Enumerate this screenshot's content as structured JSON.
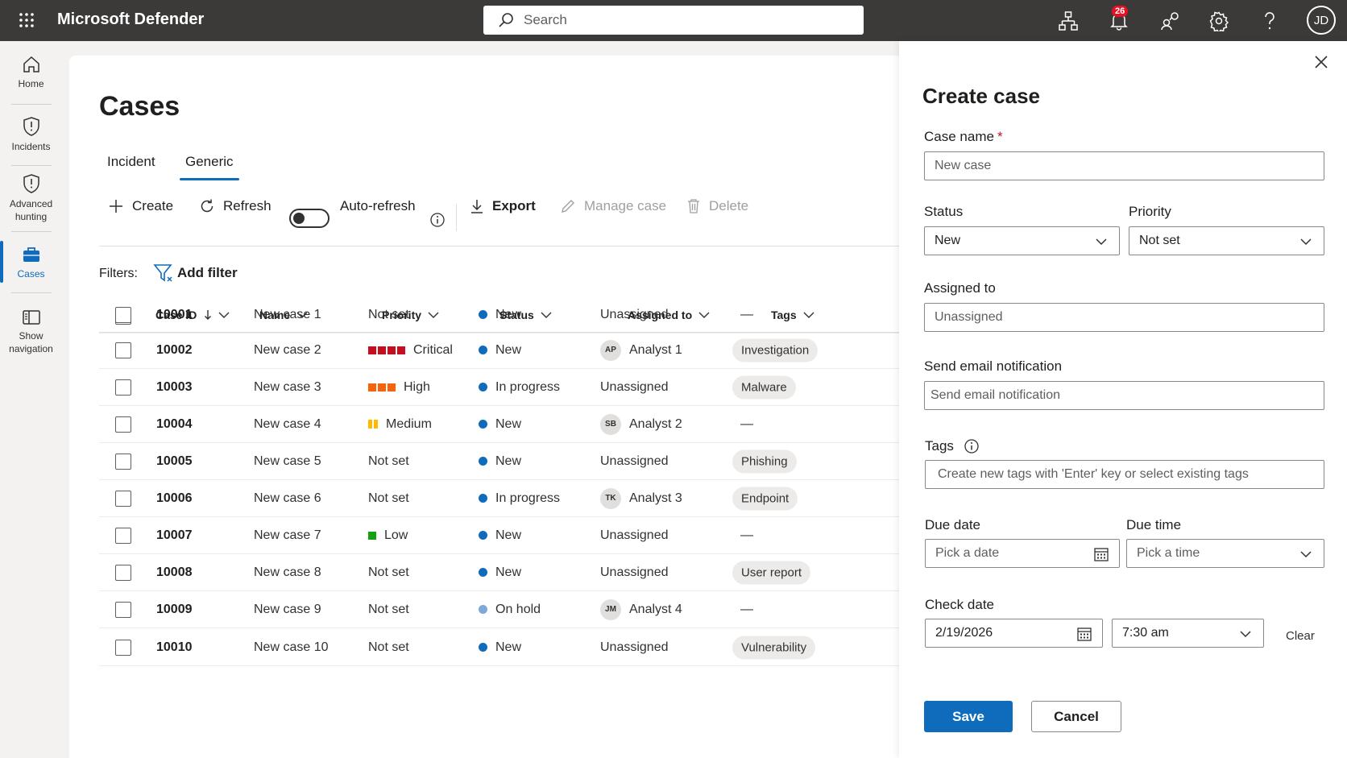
{
  "topbar": {
    "brand": "Microsoft Defender",
    "search_placeholder": "Search",
    "notifications_count": "26",
    "avatar_initials": "JD"
  },
  "leftnav": {
    "items": [
      {
        "label": "Home",
        "icon": "home-icon"
      },
      {
        "label": "Incidents",
        "icon": "shield-icon"
      },
      {
        "label": "Advanced hunting",
        "icon": "shield-icon"
      },
      {
        "label": "Cases",
        "icon": "briefcase-icon",
        "active": true
      },
      {
        "label": "Show navigation",
        "icon": "panel-icon"
      }
    ]
  },
  "main": {
    "title": "Cases",
    "tabs": [
      {
        "label": "Incident",
        "active": false
      },
      {
        "label": "Generic",
        "active": true
      }
    ],
    "toolbar": {
      "create": "Create",
      "refresh": "Refresh",
      "auto_refresh": "Auto-refresh",
      "export": "Export",
      "manage_case": "Manage case",
      "delete": "Delete"
    },
    "filters_label": "Filters:",
    "add_filter": "Add filter",
    "columns": {
      "case_id": "Case ID",
      "name": "Name",
      "priority": "Priority",
      "status": "Status",
      "assigned_to": "Assigned to",
      "tags": "Tags"
    },
    "rows": [
      {
        "id": "10001",
        "name": "New case 1",
        "priority": "Not set",
        "status": "New",
        "assigned": "Unassigned",
        "initials": "",
        "tag": "—"
      },
      {
        "id": "10002",
        "name": "New case 2",
        "priority": "Critical",
        "status": "New",
        "assigned": "Analyst 1",
        "initials": "AP",
        "tag": "Investigation"
      },
      {
        "id": "10003",
        "name": "New case 3",
        "priority": "High",
        "status": "In progress",
        "assigned": "Unassigned",
        "initials": "",
        "tag": "Malware"
      },
      {
        "id": "10004",
        "name": "New case 4",
        "priority": "Medium",
        "status": "New",
        "assigned": "Analyst 2",
        "initials": "SB",
        "tag": "—"
      },
      {
        "id": "10005",
        "name": "New case 5",
        "priority": "Not set",
        "status": "New",
        "assigned": "Unassigned",
        "initials": "",
        "tag": "Phishing"
      },
      {
        "id": "10006",
        "name": "New case 6",
        "priority": "Not set",
        "status": "In progress",
        "assigned": "Analyst 3",
        "initials": "TK",
        "tag": "Endpoint"
      },
      {
        "id": "10007",
        "name": "New case 7",
        "priority": "Low",
        "status": "New",
        "assigned": "Unassigned",
        "initials": "",
        "tag": "—"
      },
      {
        "id": "10008",
        "name": "New case 8",
        "priority": "Not set",
        "status": "New",
        "assigned": "Unassigned",
        "initials": "",
        "tag": "User report"
      },
      {
        "id": "10009",
        "name": "New case 9",
        "priority": "Not set",
        "status": "On hold",
        "assigned": "Analyst 4",
        "initials": "JM",
        "tag": "—"
      },
      {
        "id": "10010",
        "name": "New case 10",
        "priority": "Not set",
        "status": "New",
        "assigned": "Unassigned",
        "initials": "",
        "tag": "Vulnerability"
      }
    ]
  },
  "colors": {
    "accent": "#0f6cbd",
    "critical": "#c50f1f",
    "high": "#f7630c",
    "medium": "#ffb900",
    "low": "#13a10e",
    "status_new": "#0f6cbd",
    "status_onhold": "#7fa7d8"
  },
  "panel": {
    "title": "Create case",
    "case_name_label": "Case name",
    "case_name_required": "*",
    "case_name_placeholder": "New case",
    "status_label": "Status",
    "status_value": "New",
    "priority_label": "Priority",
    "priority_value": "Not set",
    "assigned_label": "Assigned to",
    "assigned_placeholder": "Unassigned",
    "email_label": "Send email notification",
    "email_placeholder": "Send email notification",
    "tags_label": "Tags",
    "tags_placeholder": "Create new tags with 'Enter' key or select existing tags",
    "due_date_label": "Due date",
    "due_date_placeholder": "Pick a date",
    "due_time_label": "Due time",
    "due_time_placeholder": "Pick a time",
    "check_date_label": "Check date",
    "check_date_value": "2/19/2026",
    "check_time_value": "7:30 am",
    "clear": "Clear",
    "save": "Save",
    "cancel": "Cancel"
  }
}
